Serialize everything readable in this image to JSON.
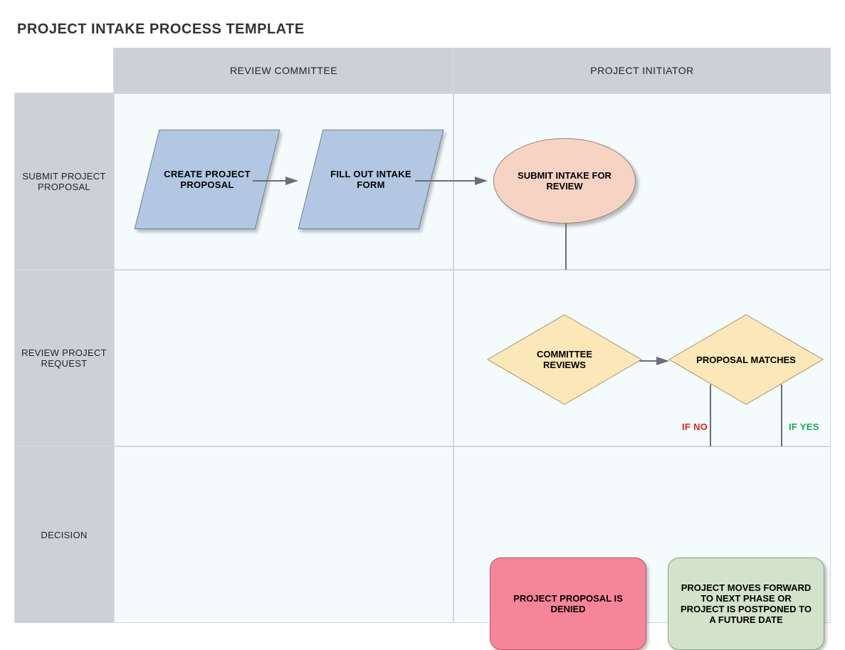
{
  "title": "PROJECT INTAKE PROCESS TEMPLATE",
  "columns": {
    "col1": "REVIEW COMMITTEE",
    "col2": "PROJECT INITIATOR"
  },
  "rows": {
    "r1": "SUBMIT PROJECT PROPOSAL",
    "r2": "REVIEW PROJECT REQUEST",
    "r3": "DECISION"
  },
  "nodes": {
    "create_proposal": "CREATE PROJECT PROPOSAL",
    "fill_form": "FILL OUT INTAKE FORM",
    "submit_review": "SUBMIT INTAKE FOR REVIEW",
    "committee_reviews": "COMMITTEE REVIEWS",
    "proposal_matches": "PROPOSAL MATCHES",
    "denied": "PROJECT PROPOSAL IS DENIED",
    "approved": "PROJECT MOVES FORWARD TO NEXT PHASE OR PROJECT IS POSTPONED TO A FUTURE DATE"
  },
  "labels": {
    "if_no": "IF NO",
    "if_yes": "IF YES"
  },
  "chart_data": {
    "type": "flowchart-swimlane",
    "title": "PROJECT INTAKE PROCESS TEMPLATE",
    "lanes_horizontal": [
      "SUBMIT PROJECT PROPOSAL",
      "REVIEW PROJECT REQUEST",
      "DECISION"
    ],
    "lanes_vertical": [
      "REVIEW COMMITTEE",
      "PROJECT INITIATOR"
    ],
    "nodes": [
      {
        "id": "create_proposal",
        "label": "CREATE PROJECT PROPOSAL",
        "shape": "parallelogram",
        "row": "SUBMIT PROJECT PROPOSAL",
        "col": "REVIEW COMMITTEE"
      },
      {
        "id": "fill_form",
        "label": "FILL OUT INTAKE FORM",
        "shape": "parallelogram",
        "row": "SUBMIT PROJECT PROPOSAL",
        "col": "REVIEW COMMITTEE"
      },
      {
        "id": "submit_review",
        "label": "SUBMIT INTAKE FOR REVIEW",
        "shape": "ellipse",
        "row": "SUBMIT PROJECT PROPOSAL",
        "col": "PROJECT INITIATOR"
      },
      {
        "id": "committee_reviews",
        "label": "COMMITTEE REVIEWS",
        "shape": "diamond",
        "row": "REVIEW PROJECT REQUEST",
        "col": "PROJECT INITIATOR"
      },
      {
        "id": "proposal_matches",
        "label": "PROPOSAL MATCHES",
        "shape": "diamond",
        "row": "REVIEW PROJECT REQUEST",
        "col": "PROJECT INITIATOR"
      },
      {
        "id": "denied",
        "label": "PROJECT PROPOSAL IS DENIED",
        "shape": "rounded-rect",
        "row": "DECISION",
        "col": "PROJECT INITIATOR"
      },
      {
        "id": "approved",
        "label": "PROJECT MOVES FORWARD TO NEXT PHASE OR PROJECT IS POSTPONED TO A FUTURE DATE",
        "shape": "rounded-rect",
        "row": "DECISION",
        "col": "PROJECT INITIATOR"
      }
    ],
    "edges": [
      {
        "from": "create_proposal",
        "to": "fill_form"
      },
      {
        "from": "fill_form",
        "to": "submit_review"
      },
      {
        "from": "submit_review",
        "to": "committee_reviews"
      },
      {
        "from": "committee_reviews",
        "to": "proposal_matches"
      },
      {
        "from": "proposal_matches",
        "to": "denied",
        "label": "IF NO"
      },
      {
        "from": "proposal_matches",
        "to": "approved",
        "label": "IF YES"
      }
    ]
  }
}
